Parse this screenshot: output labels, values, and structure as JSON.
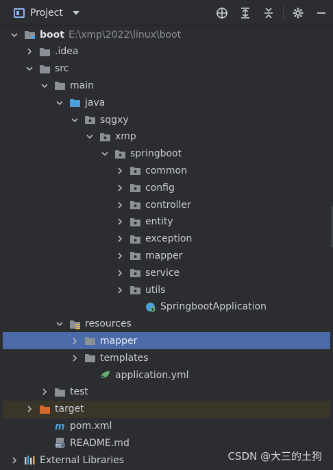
{
  "toolbar": {
    "title": "Project",
    "icons": [
      "locate-icon",
      "expand-all-icon",
      "collapse-all-icon",
      "settings-icon",
      "minimize-icon"
    ]
  },
  "tree": [
    {
      "label": "boot",
      "path": "E:\\xmp\\2022\\linux\\boot",
      "icon": "module-folder",
      "expanded": true,
      "indent": 0
    },
    {
      "label": ".idea",
      "icon": "folder",
      "expanded": false,
      "indent": 1
    },
    {
      "label": "src",
      "icon": "folder",
      "expanded": true,
      "indent": 1
    },
    {
      "label": "main",
      "icon": "folder",
      "expanded": true,
      "indent": 2
    },
    {
      "label": "java",
      "icon": "source-folder",
      "expanded": true,
      "indent": 3
    },
    {
      "label": "sqgxy",
      "icon": "package",
      "expanded": true,
      "indent": 4
    },
    {
      "label": "xmp",
      "icon": "package",
      "expanded": true,
      "indent": 5
    },
    {
      "label": "springboot",
      "icon": "package",
      "expanded": true,
      "indent": 6
    },
    {
      "label": "common",
      "icon": "package",
      "expanded": false,
      "indent": 7
    },
    {
      "label": "config",
      "icon": "package",
      "expanded": false,
      "indent": 7
    },
    {
      "label": "controller",
      "icon": "package",
      "expanded": false,
      "indent": 7
    },
    {
      "label": "entity",
      "icon": "package",
      "expanded": false,
      "indent": 7
    },
    {
      "label": "exception",
      "icon": "package",
      "expanded": false,
      "indent": 7
    },
    {
      "label": "mapper",
      "icon": "package",
      "expanded": false,
      "indent": 7
    },
    {
      "label": "service",
      "icon": "package",
      "expanded": false,
      "indent": 7
    },
    {
      "label": "utils",
      "icon": "package",
      "expanded": false,
      "indent": 7
    },
    {
      "label": "SpringbootApplication",
      "icon": "spring-class",
      "indent": 8
    },
    {
      "label": "resources",
      "icon": "resources-folder",
      "expanded": true,
      "indent": 3
    },
    {
      "label": "mapper",
      "icon": "folder",
      "expanded": false,
      "indent": 4,
      "selected": true
    },
    {
      "label": "templates",
      "icon": "folder",
      "expanded": false,
      "indent": 4
    },
    {
      "label": "application.yml",
      "icon": "yaml-file",
      "indent": 5
    },
    {
      "label": "test",
      "icon": "folder",
      "expanded": false,
      "indent": 2
    },
    {
      "label": "target",
      "icon": "excluded-folder",
      "expanded": false,
      "indent": 1,
      "target": true
    },
    {
      "label": "pom.xml",
      "icon": "maven-file",
      "indent": 2
    },
    {
      "label": "README.md",
      "icon": "markdown-file",
      "indent": 2
    },
    {
      "label": "External Libraries",
      "icon": "libraries",
      "expanded": false,
      "indent": 0
    }
  ],
  "colors": {
    "background": "#2b2d30",
    "selected": "#4a6aa8",
    "folder": "#8c9096",
    "source_folder": "#4a9fd8",
    "excluded_folder": "#d3692f",
    "spring": "#6aab73"
  },
  "watermark": "CSDN @大三的土狗"
}
